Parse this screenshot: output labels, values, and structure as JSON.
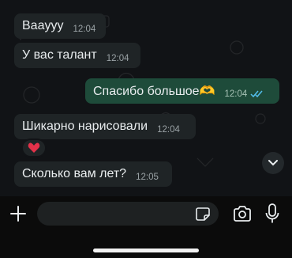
{
  "messages": [
    {
      "text": "Вaayyy",
      "time": "12:04",
      "direction": "in"
    },
    {
      "text": "У вас талант",
      "time": "12:04",
      "direction": "in"
    },
    {
      "text": "Спасибо большое🫶",
      "time": "12:04",
      "direction": "out",
      "status": "read"
    },
    {
      "text": "Шикарно нарисовали",
      "time": "12:04",
      "direction": "in",
      "reaction": "heart"
    },
    {
      "text": "Сколько вам лет?",
      "time": "12:05",
      "direction": "in"
    }
  ],
  "colors": {
    "background": "#111316",
    "incoming_bubble": "#1f2426",
    "outgoing_bubble": "#1e4b3a",
    "read_ticks": "#53bdeb",
    "reaction_heart": "#e3324a"
  },
  "icons": {
    "plus": "plus-icon",
    "sticker": "sticker-icon",
    "camera": "camera-icon",
    "mic": "microphone-icon",
    "scroll": "chevron-down-icon"
  }
}
